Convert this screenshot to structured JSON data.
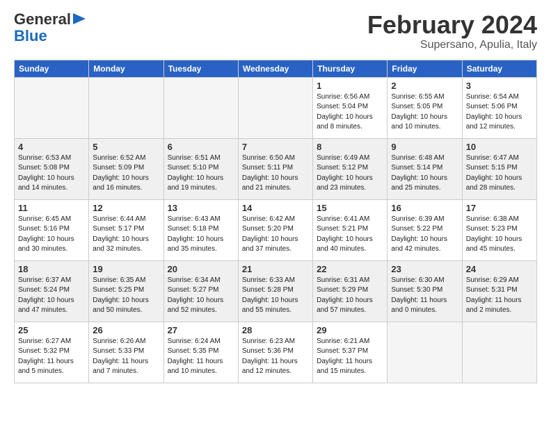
{
  "header": {
    "logo_general": "General",
    "logo_blue": "Blue",
    "month_title": "February 2024",
    "subtitle": "Supersano, Apulia, Italy"
  },
  "days_of_week": [
    "Sunday",
    "Monday",
    "Tuesday",
    "Wednesday",
    "Thursday",
    "Friday",
    "Saturday"
  ],
  "weeks": [
    [
      {
        "day": "",
        "detail": ""
      },
      {
        "day": "",
        "detail": ""
      },
      {
        "day": "",
        "detail": ""
      },
      {
        "day": "",
        "detail": ""
      },
      {
        "day": "1",
        "detail": "Sunrise: 6:56 AM\nSunset: 5:04 PM\nDaylight: 10 hours\nand 8 minutes."
      },
      {
        "day": "2",
        "detail": "Sunrise: 6:55 AM\nSunset: 5:05 PM\nDaylight: 10 hours\nand 10 minutes."
      },
      {
        "day": "3",
        "detail": "Sunrise: 6:54 AM\nSunset: 5:06 PM\nDaylight: 10 hours\nand 12 minutes."
      }
    ],
    [
      {
        "day": "4",
        "detail": "Sunrise: 6:53 AM\nSunset: 5:08 PM\nDaylight: 10 hours\nand 14 minutes."
      },
      {
        "day": "5",
        "detail": "Sunrise: 6:52 AM\nSunset: 5:09 PM\nDaylight: 10 hours\nand 16 minutes."
      },
      {
        "day": "6",
        "detail": "Sunrise: 6:51 AM\nSunset: 5:10 PM\nDaylight: 10 hours\nand 19 minutes."
      },
      {
        "day": "7",
        "detail": "Sunrise: 6:50 AM\nSunset: 5:11 PM\nDaylight: 10 hours\nand 21 minutes."
      },
      {
        "day": "8",
        "detail": "Sunrise: 6:49 AM\nSunset: 5:12 PM\nDaylight: 10 hours\nand 23 minutes."
      },
      {
        "day": "9",
        "detail": "Sunrise: 6:48 AM\nSunset: 5:14 PM\nDaylight: 10 hours\nand 25 minutes."
      },
      {
        "day": "10",
        "detail": "Sunrise: 6:47 AM\nSunset: 5:15 PM\nDaylight: 10 hours\nand 28 minutes."
      }
    ],
    [
      {
        "day": "11",
        "detail": "Sunrise: 6:45 AM\nSunset: 5:16 PM\nDaylight: 10 hours\nand 30 minutes."
      },
      {
        "day": "12",
        "detail": "Sunrise: 6:44 AM\nSunset: 5:17 PM\nDaylight: 10 hours\nand 32 minutes."
      },
      {
        "day": "13",
        "detail": "Sunrise: 6:43 AM\nSunset: 5:18 PM\nDaylight: 10 hours\nand 35 minutes."
      },
      {
        "day": "14",
        "detail": "Sunrise: 6:42 AM\nSunset: 5:20 PM\nDaylight: 10 hours\nand 37 minutes."
      },
      {
        "day": "15",
        "detail": "Sunrise: 6:41 AM\nSunset: 5:21 PM\nDaylight: 10 hours\nand 40 minutes."
      },
      {
        "day": "16",
        "detail": "Sunrise: 6:39 AM\nSunset: 5:22 PM\nDaylight: 10 hours\nand 42 minutes."
      },
      {
        "day": "17",
        "detail": "Sunrise: 6:38 AM\nSunset: 5:23 PM\nDaylight: 10 hours\nand 45 minutes."
      }
    ],
    [
      {
        "day": "18",
        "detail": "Sunrise: 6:37 AM\nSunset: 5:24 PM\nDaylight: 10 hours\nand 47 minutes."
      },
      {
        "day": "19",
        "detail": "Sunrise: 6:35 AM\nSunset: 5:25 PM\nDaylight: 10 hours\nand 50 minutes."
      },
      {
        "day": "20",
        "detail": "Sunrise: 6:34 AM\nSunset: 5:27 PM\nDaylight: 10 hours\nand 52 minutes."
      },
      {
        "day": "21",
        "detail": "Sunrise: 6:33 AM\nSunset: 5:28 PM\nDaylight: 10 hours\nand 55 minutes."
      },
      {
        "day": "22",
        "detail": "Sunrise: 6:31 AM\nSunset: 5:29 PM\nDaylight: 10 hours\nand 57 minutes."
      },
      {
        "day": "23",
        "detail": "Sunrise: 6:30 AM\nSunset: 5:30 PM\nDaylight: 11 hours\nand 0 minutes."
      },
      {
        "day": "24",
        "detail": "Sunrise: 6:29 AM\nSunset: 5:31 PM\nDaylight: 11 hours\nand 2 minutes."
      }
    ],
    [
      {
        "day": "25",
        "detail": "Sunrise: 6:27 AM\nSunset: 5:32 PM\nDaylight: 11 hours\nand 5 minutes."
      },
      {
        "day": "26",
        "detail": "Sunrise: 6:26 AM\nSunset: 5:33 PM\nDaylight: 11 hours\nand 7 minutes."
      },
      {
        "day": "27",
        "detail": "Sunrise: 6:24 AM\nSunset: 5:35 PM\nDaylight: 11 hours\nand 10 minutes."
      },
      {
        "day": "28",
        "detail": "Sunrise: 6:23 AM\nSunset: 5:36 PM\nDaylight: 11 hours\nand 12 minutes."
      },
      {
        "day": "29",
        "detail": "Sunrise: 6:21 AM\nSunset: 5:37 PM\nDaylight: 11 hours\nand 15 minutes."
      },
      {
        "day": "",
        "detail": ""
      },
      {
        "day": "",
        "detail": ""
      }
    ]
  ]
}
